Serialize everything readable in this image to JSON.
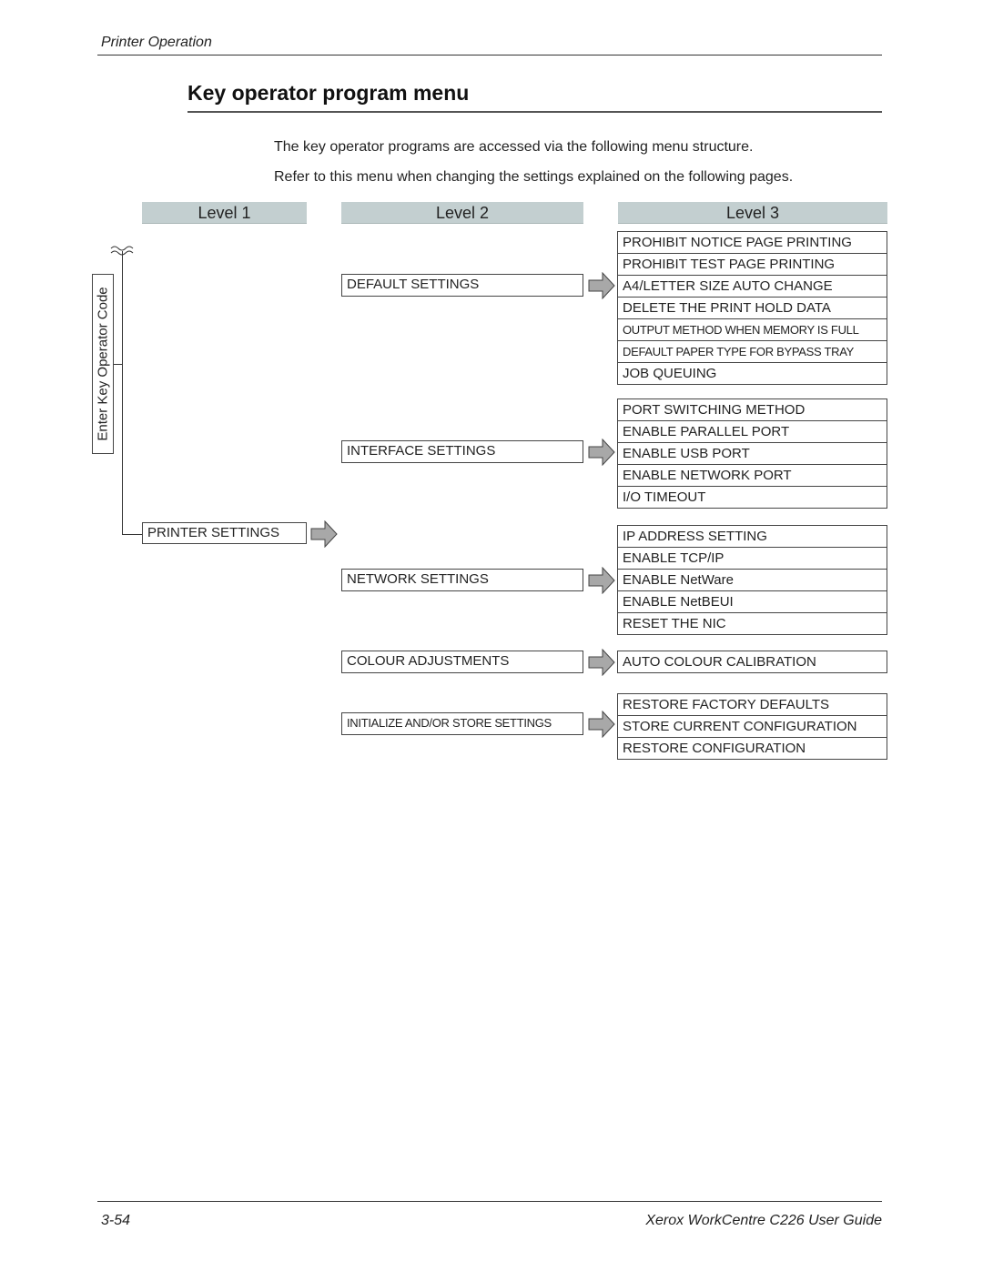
{
  "header": {
    "running_head": "Printer Operation"
  },
  "page_title": "Key operator program menu",
  "intro": [
    "The key operator programs are accessed via the following menu structure.",
    "Refer to this menu when changing the settings explained on the following pages."
  ],
  "levels": [
    "Level 1",
    "Level 2",
    "Level 3"
  ],
  "entry_label": "Enter Key Operator Code",
  "level1": {
    "label": "PRINTER SETTINGS"
  },
  "groups": [
    {
      "label": "DEFAULT SETTINGS",
      "items": [
        "PROHIBIT NOTICE PAGE PRINTING",
        "PROHIBIT TEST PAGE PRINTING",
        "A4/LETTER SIZE AUTO CHANGE",
        "DELETE THE PRINT HOLD DATA",
        "OUTPUT METHOD WHEN MEMORY IS FULL",
        "DEFAULT PAPER TYPE FOR BYPASS TRAY",
        "JOB QUEUING"
      ]
    },
    {
      "label": "INTERFACE SETTINGS",
      "items": [
        "PORT SWITCHING METHOD",
        "ENABLE PARALLEL PORT",
        "ENABLE USB PORT",
        "ENABLE NETWORK PORT",
        "I/O TIMEOUT"
      ]
    },
    {
      "label": "NETWORK SETTINGS",
      "items": [
        "IP ADDRESS SETTING",
        "ENABLE TCP/IP",
        "ENABLE NetWare",
        "ENABLE NetBEUI",
        "RESET THE NIC"
      ]
    },
    {
      "label": "COLOUR ADJUSTMENTS",
      "items": [
        "AUTO COLOUR CALIBRATION"
      ]
    },
    {
      "label": "INITIALIZE AND/OR STORE SETTINGS",
      "items": [
        "RESTORE FACTORY DEFAULTS",
        "STORE CURRENT CONFIGURATION",
        "RESTORE CONFIGURATION"
      ]
    }
  ],
  "footer": {
    "page_number": "3-54",
    "guide_title": "Xerox WorkCentre C226 User Guide"
  },
  "colors": {
    "level_header_bg": "#c3cfd0",
    "arrow_fill": "#a8a8a8"
  }
}
